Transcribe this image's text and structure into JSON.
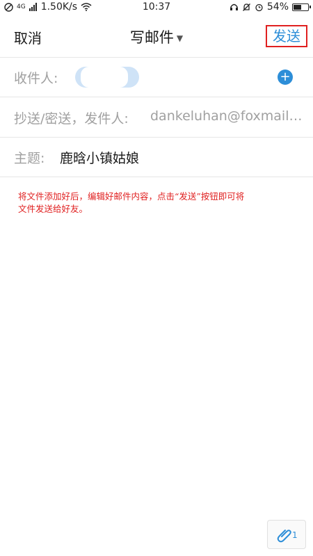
{
  "status_bar": {
    "network_speed": "1.50K/s",
    "signal_small_text": "4G",
    "time": "10:37",
    "battery": "54%"
  },
  "header": {
    "cancel_label": "取消",
    "title": "写邮件",
    "send_label": "发送"
  },
  "form": {
    "recipients_label": "收件人:",
    "cc_label": "抄送/密送，发件人:",
    "cc_sender_value": "dankeluhan@foxmail.com",
    "subject_label": "主题:",
    "subject_value": "鹿晗小镇姑娘"
  },
  "body": {
    "instruction_line1": "将文件添加好后，编辑好邮件内容，点击“发送”按钮即可将",
    "instruction_line2": "文件发送给好友。"
  },
  "attachment": {
    "count": "1"
  },
  "colors": {
    "accent": "#2d8ed8",
    "highlight_red": "#e02020",
    "label_gray": "#a0a0a0"
  }
}
